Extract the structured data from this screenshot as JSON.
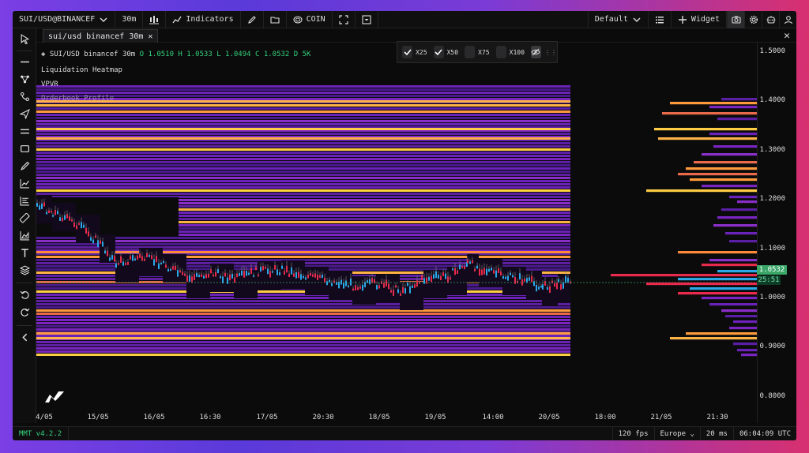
{
  "toolbar": {
    "symbol": "SUI/USD@BINANCEF",
    "timeframe": "30m",
    "indicators_label": "Indicators",
    "coin_label": "COIN",
    "layout_label": "Default",
    "widget_label": "Widget"
  },
  "tab": {
    "title": "sui/usd binancef 30m",
    "close": "✕"
  },
  "legend": {
    "symbol_line": "SUI/USD binancef 30m",
    "o": "O 1.0510",
    "h": "H 1.0533",
    "l": "L 1.0494",
    "c": "C 1.0532",
    "d": "D 5K",
    "indicators": [
      "Liquidation Heatmap",
      "VPVR",
      "Orderbook Profile"
    ]
  },
  "multipliers": [
    {
      "label": "X25",
      "checked": true
    },
    {
      "label": "X50",
      "checked": true
    },
    {
      "label": "X75",
      "checked": false
    },
    {
      "label": "X100",
      "checked": false
    }
  ],
  "price_axis": {
    "labels": [
      "1.5000",
      "1.4000",
      "1.3000",
      "1.2000",
      "1.1000",
      "1.0000",
      "0.9000",
      "0.8000"
    ],
    "current_price": "1.0532",
    "countdown": "25:51"
  },
  "time_axis": {
    "labels": [
      "4/05",
      "15/05",
      "16/05",
      "16:30",
      "17/05",
      "20:30",
      "18/05",
      "19/05",
      "14:00",
      "20/05",
      "18:00",
      "21/05",
      "21:30"
    ]
  },
  "status": {
    "version": "MMT v4.2.2",
    "fps": "120 fps",
    "region": "Europe",
    "latency": "20 ms",
    "clock": "06:04:09 UTC"
  },
  "colors": {
    "bid": "#2aa8e8",
    "ask": "#e82a4c",
    "up_candle": "#2aa8e8",
    "down_candle": "#e82a4c",
    "last_price": "#3aa668"
  }
}
